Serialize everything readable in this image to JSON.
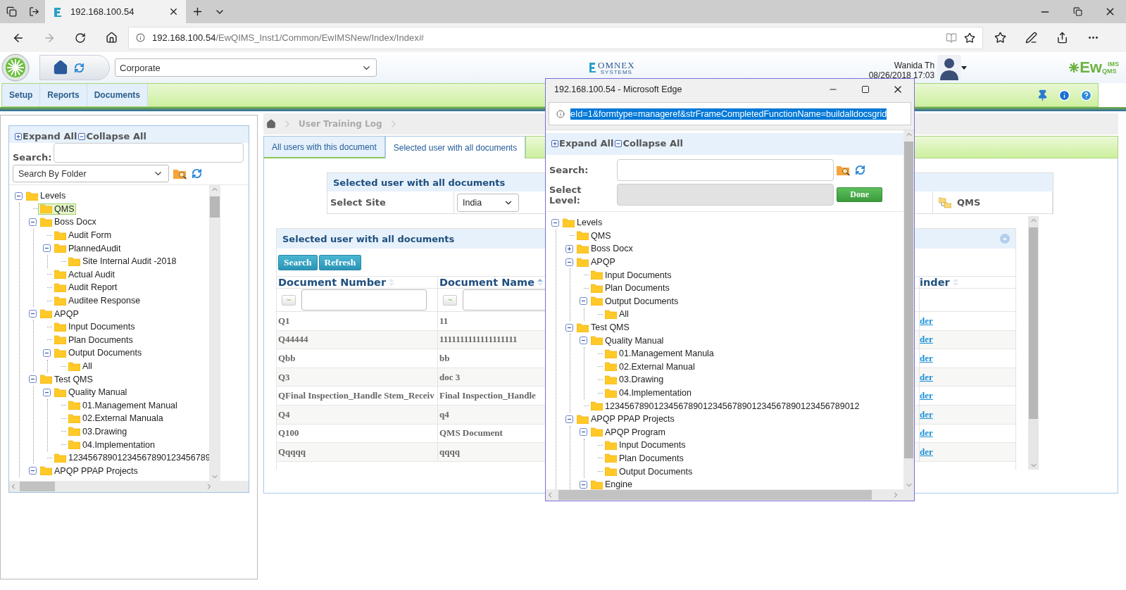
{
  "browser": {
    "tabs": [
      {
        "title": "192.168.100.54",
        "selected": true
      }
    ],
    "url_host": "192.168.100.54",
    "url_path": "/EwQIMS_Inst1/Common/EwIMSNew/Index/Index#"
  },
  "header": {
    "site_select": "Corporate",
    "company_logo": "OMNEX",
    "company_logo_sub": "SYSTEMS",
    "user_name": "Wanida Th",
    "datetime": "08/26/2018 17:03",
    "product_logo": "Ew",
    "product_logo_sup": "IMS",
    "product_logo_sub": "QMS"
  },
  "menu": [
    {
      "label": "Setup"
    },
    {
      "label": "Reports"
    },
    {
      "label": "Documents"
    }
  ],
  "left_panel": {
    "expand_all": "Expand All",
    "collapse_all": "Collapse All",
    "search_label": "Search:",
    "search_mode": "Search By Folder",
    "tree": [
      {
        "label": "Levels",
        "expanded": true,
        "selected": false,
        "children": [
          {
            "label": "QMS",
            "selected": true
          },
          {
            "label": "Boss Docx",
            "expanded": true,
            "selected": false,
            "children": [
              {
                "label": "Audit Form",
                "selected": false
              },
              {
                "label": "PlannedAudit",
                "expanded": true,
                "selected": false,
                "children": [
                  {
                    "label": "Site Internal Audit -2018",
                    "selected": false
                  }
                ]
              },
              {
                "label": "Actual Audit",
                "selected": false
              },
              {
                "label": "Audit Report",
                "selected": false
              },
              {
                "label": "Auditee Response",
                "selected": false
              }
            ]
          },
          {
            "label": "APQP",
            "expanded": true,
            "selected": false,
            "children": [
              {
                "label": "Input Documents",
                "selected": false
              },
              {
                "label": "Plan Documents",
                "selected": false
              },
              {
                "label": "Output Documents",
                "expanded": true,
                "selected": false,
                "children": [
                  {
                    "label": "All",
                    "selected": false
                  }
                ]
              }
            ]
          },
          {
            "label": "Test QMS",
            "expanded": true,
            "selected": false,
            "children": [
              {
                "label": "Quality Manual",
                "expanded": true,
                "selected": false,
                "children": [
                  {
                    "label": "01.Management Manual",
                    "selected": false
                  },
                  {
                    "label": "02.External Manuala",
                    "selected": false
                  },
                  {
                    "label": "03.Drawing",
                    "selected": false
                  },
                  {
                    "label": "04.Implementation",
                    "selected": false
                  }
                ]
              },
              {
                "label": "12345678901234567890123456789",
                "selected": false
              }
            ]
          },
          {
            "label": "APQP PPAP Projects",
            "expanded": true,
            "selected": false
          }
        ]
      }
    ]
  },
  "breadcrumb": [
    "User Training Log"
  ],
  "tabs": [
    {
      "label": "All users with this document",
      "selected": false
    },
    {
      "label": "Selected user with all documents",
      "selected": true
    }
  ],
  "filter_panel": {
    "title": "Selected user with all documents",
    "site_label": "Select Site",
    "site_value": "India",
    "level_value": "QMS"
  },
  "grid": {
    "title": "Selected user with all documents",
    "buttons": [
      "Search",
      "Refresh"
    ],
    "columns": [
      "Document Number",
      "Document Name",
      "inder"
    ],
    "filter_button": "~",
    "rows": [
      [
        "Q1",
        "11",
        "der"
      ],
      [
        "Q44444",
        "1111111111111111111",
        "der"
      ],
      [
        "Qbb",
        "bb",
        "der"
      ],
      [
        "Q3",
        "doc 3",
        "der"
      ],
      [
        "QFinal Inspection_Handle Stem_Receiv",
        "Final Inspection_Handle",
        "der"
      ],
      [
        "Q4",
        "q4",
        "der"
      ],
      [
        "Q100",
        "QMS Document",
        "der"
      ],
      [
        "Qqqqq",
        "qqqq",
        "der"
      ]
    ]
  },
  "popup": {
    "title": "192.168.100.54 - Microsoft Edge",
    "url": "eId=1&formtype=manageref&strFrameCompletedFunctionName=buildalldocsgrid",
    "expand_all": "Expand All",
    "collapse_all": "Collapse All",
    "search_label": "Search:",
    "level_label": "Select Level:",
    "done": "Done",
    "tree": [
      {
        "label": "Levels",
        "expanded": true,
        "children": [
          {
            "label": "QMS"
          },
          {
            "label": "Boss Docx",
            "expanded": false
          },
          {
            "label": "APQP",
            "expanded": true,
            "children": [
              {
                "label": "Input Documents"
              },
              {
                "label": "Plan Documents"
              },
              {
                "label": "Output Documents",
                "expanded": true,
                "children": [
                  {
                    "label": "All"
                  }
                ]
              }
            ]
          },
          {
            "label": "Test QMS",
            "expanded": true,
            "children": [
              {
                "label": "Quality Manual",
                "expanded": true,
                "children": [
                  {
                    "label": "01.Management Manula"
                  },
                  {
                    "label": "02.External Manual"
                  },
                  {
                    "label": "03.Drawing"
                  },
                  {
                    "label": "04.Implementation"
                  }
                ]
              },
              {
                "label": "1234567890123456789012345678901234567890123456789012"
              }
            ]
          },
          {
            "label": "APQP PPAP Projects",
            "expanded": true,
            "children": [
              {
                "label": "APQP Program",
                "expanded": true,
                "children": [
                  {
                    "label": "Input Documents"
                  },
                  {
                    "label": "Plan Documents"
                  },
                  {
                    "label": "Output Documents"
                  }
                ]
              },
              {
                "label": "Engine",
                "expanded": true
              }
            ]
          }
        ]
      }
    ]
  }
}
